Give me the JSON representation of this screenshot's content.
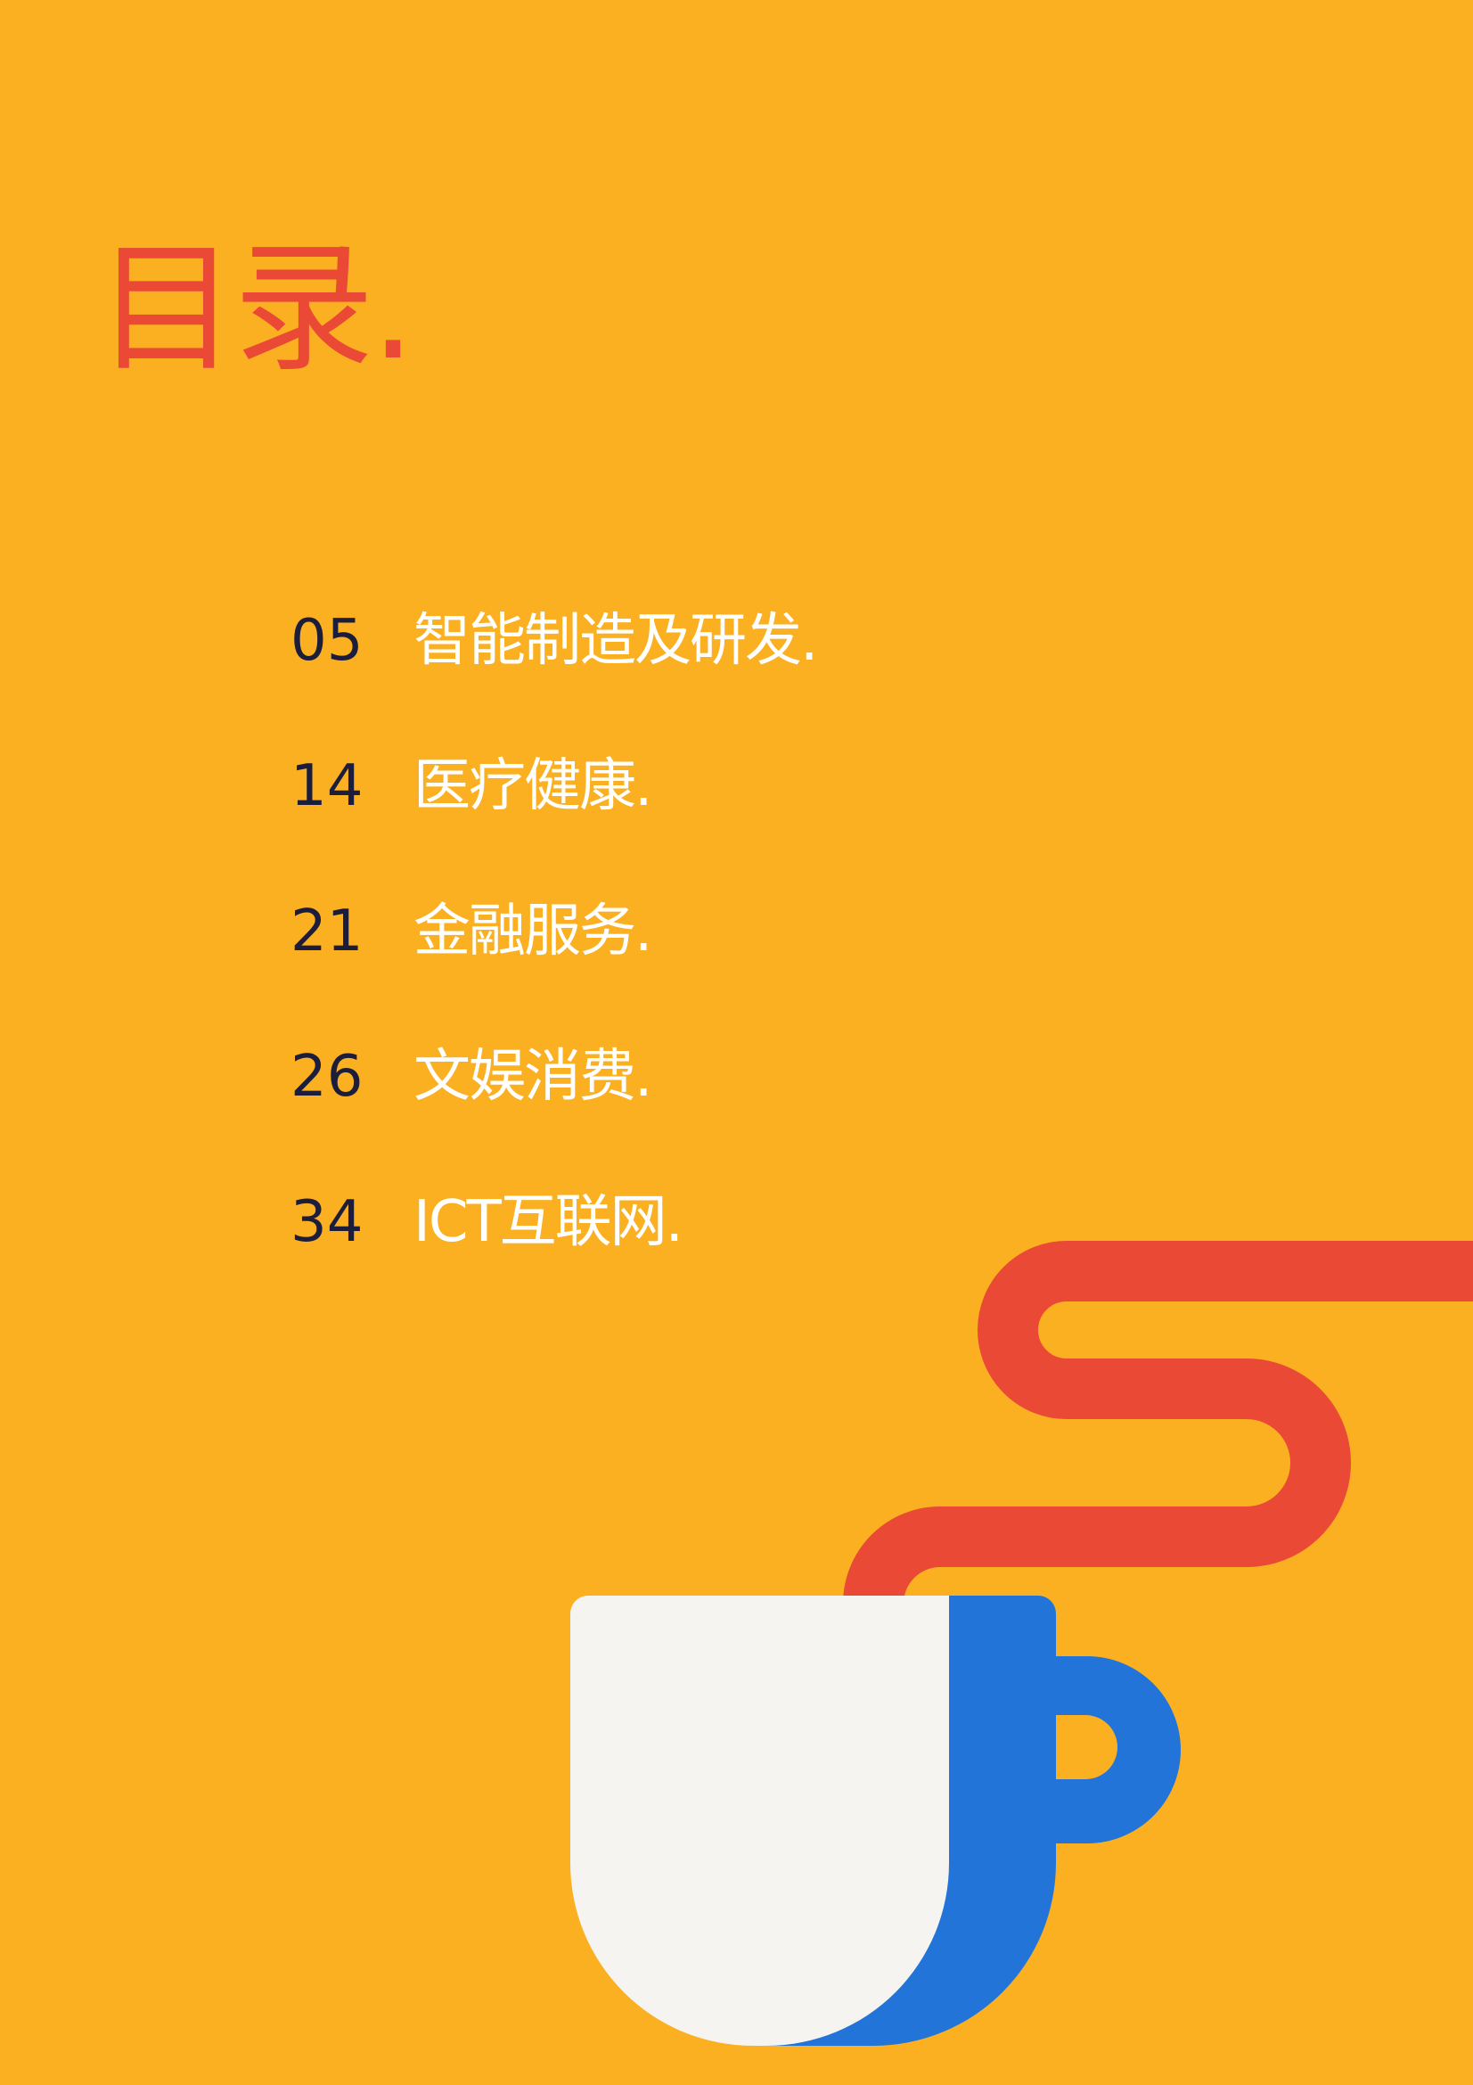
{
  "colors": {
    "background": "#FBB022",
    "title": "#E94935",
    "number": "#1B1D3A",
    "label": "#FFFFFF",
    "straw": "#E94935",
    "cup_body": "#F5F4F0",
    "cup_side": "#2374D8"
  },
  "title": "目录.",
  "toc": [
    {
      "page": "05",
      "label": "智能制造及研发."
    },
    {
      "page": "14",
      "label": "医疗健康."
    },
    {
      "page": "21",
      "label": "金融服务."
    },
    {
      "page": "26",
      "label": "文娱消费."
    },
    {
      "page": "34",
      "label": "ICT互联网."
    }
  ],
  "illustration": {
    "icon": "coffee-cup-with-straw-icon"
  }
}
